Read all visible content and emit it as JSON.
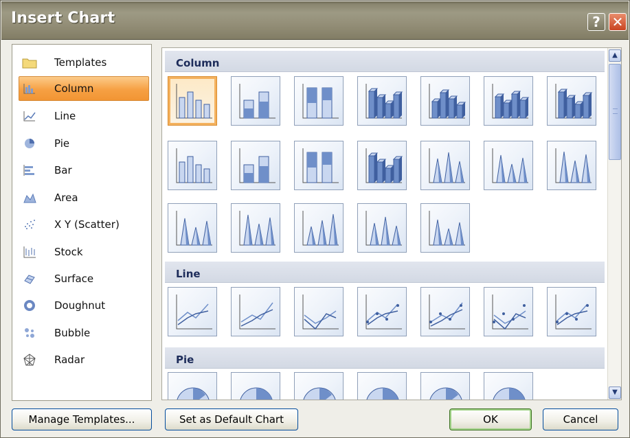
{
  "dialog": {
    "title": "Insert Chart",
    "help_label": "?",
    "close_label": "✕"
  },
  "sidebar": {
    "items": [
      {
        "label": "Templates",
        "icon": "folder-icon"
      },
      {
        "label": "Column",
        "icon": "column-chart-icon",
        "selected": true
      },
      {
        "label": "Line",
        "icon": "line-chart-icon"
      },
      {
        "label": "Pie",
        "icon": "pie-chart-icon"
      },
      {
        "label": "Bar",
        "icon": "bar-chart-icon"
      },
      {
        "label": "Area",
        "icon": "area-chart-icon"
      },
      {
        "label": "X Y (Scatter)",
        "icon": "scatter-chart-icon"
      },
      {
        "label": "Stock",
        "icon": "stock-chart-icon"
      },
      {
        "label": "Surface",
        "icon": "surface-chart-icon"
      },
      {
        "label": "Doughnut",
        "icon": "doughnut-chart-icon"
      },
      {
        "label": "Bubble",
        "icon": "bubble-chart-icon"
      },
      {
        "label": "Radar",
        "icon": "radar-chart-icon"
      }
    ]
  },
  "gallery": {
    "sections": [
      {
        "label": "Column"
      },
      {
        "label": "Line"
      },
      {
        "label": "Pie"
      }
    ]
  },
  "buttons": {
    "manage_templates": "Manage Templates...",
    "set_default": "Set as Default Chart",
    "ok": "OK",
    "cancel": "Cancel"
  },
  "colors": {
    "selection_orange": "#f6a043",
    "title_bar": "#948f78",
    "section_header": "#d3d9e4",
    "chart_blue": "#5a7bb8"
  }
}
